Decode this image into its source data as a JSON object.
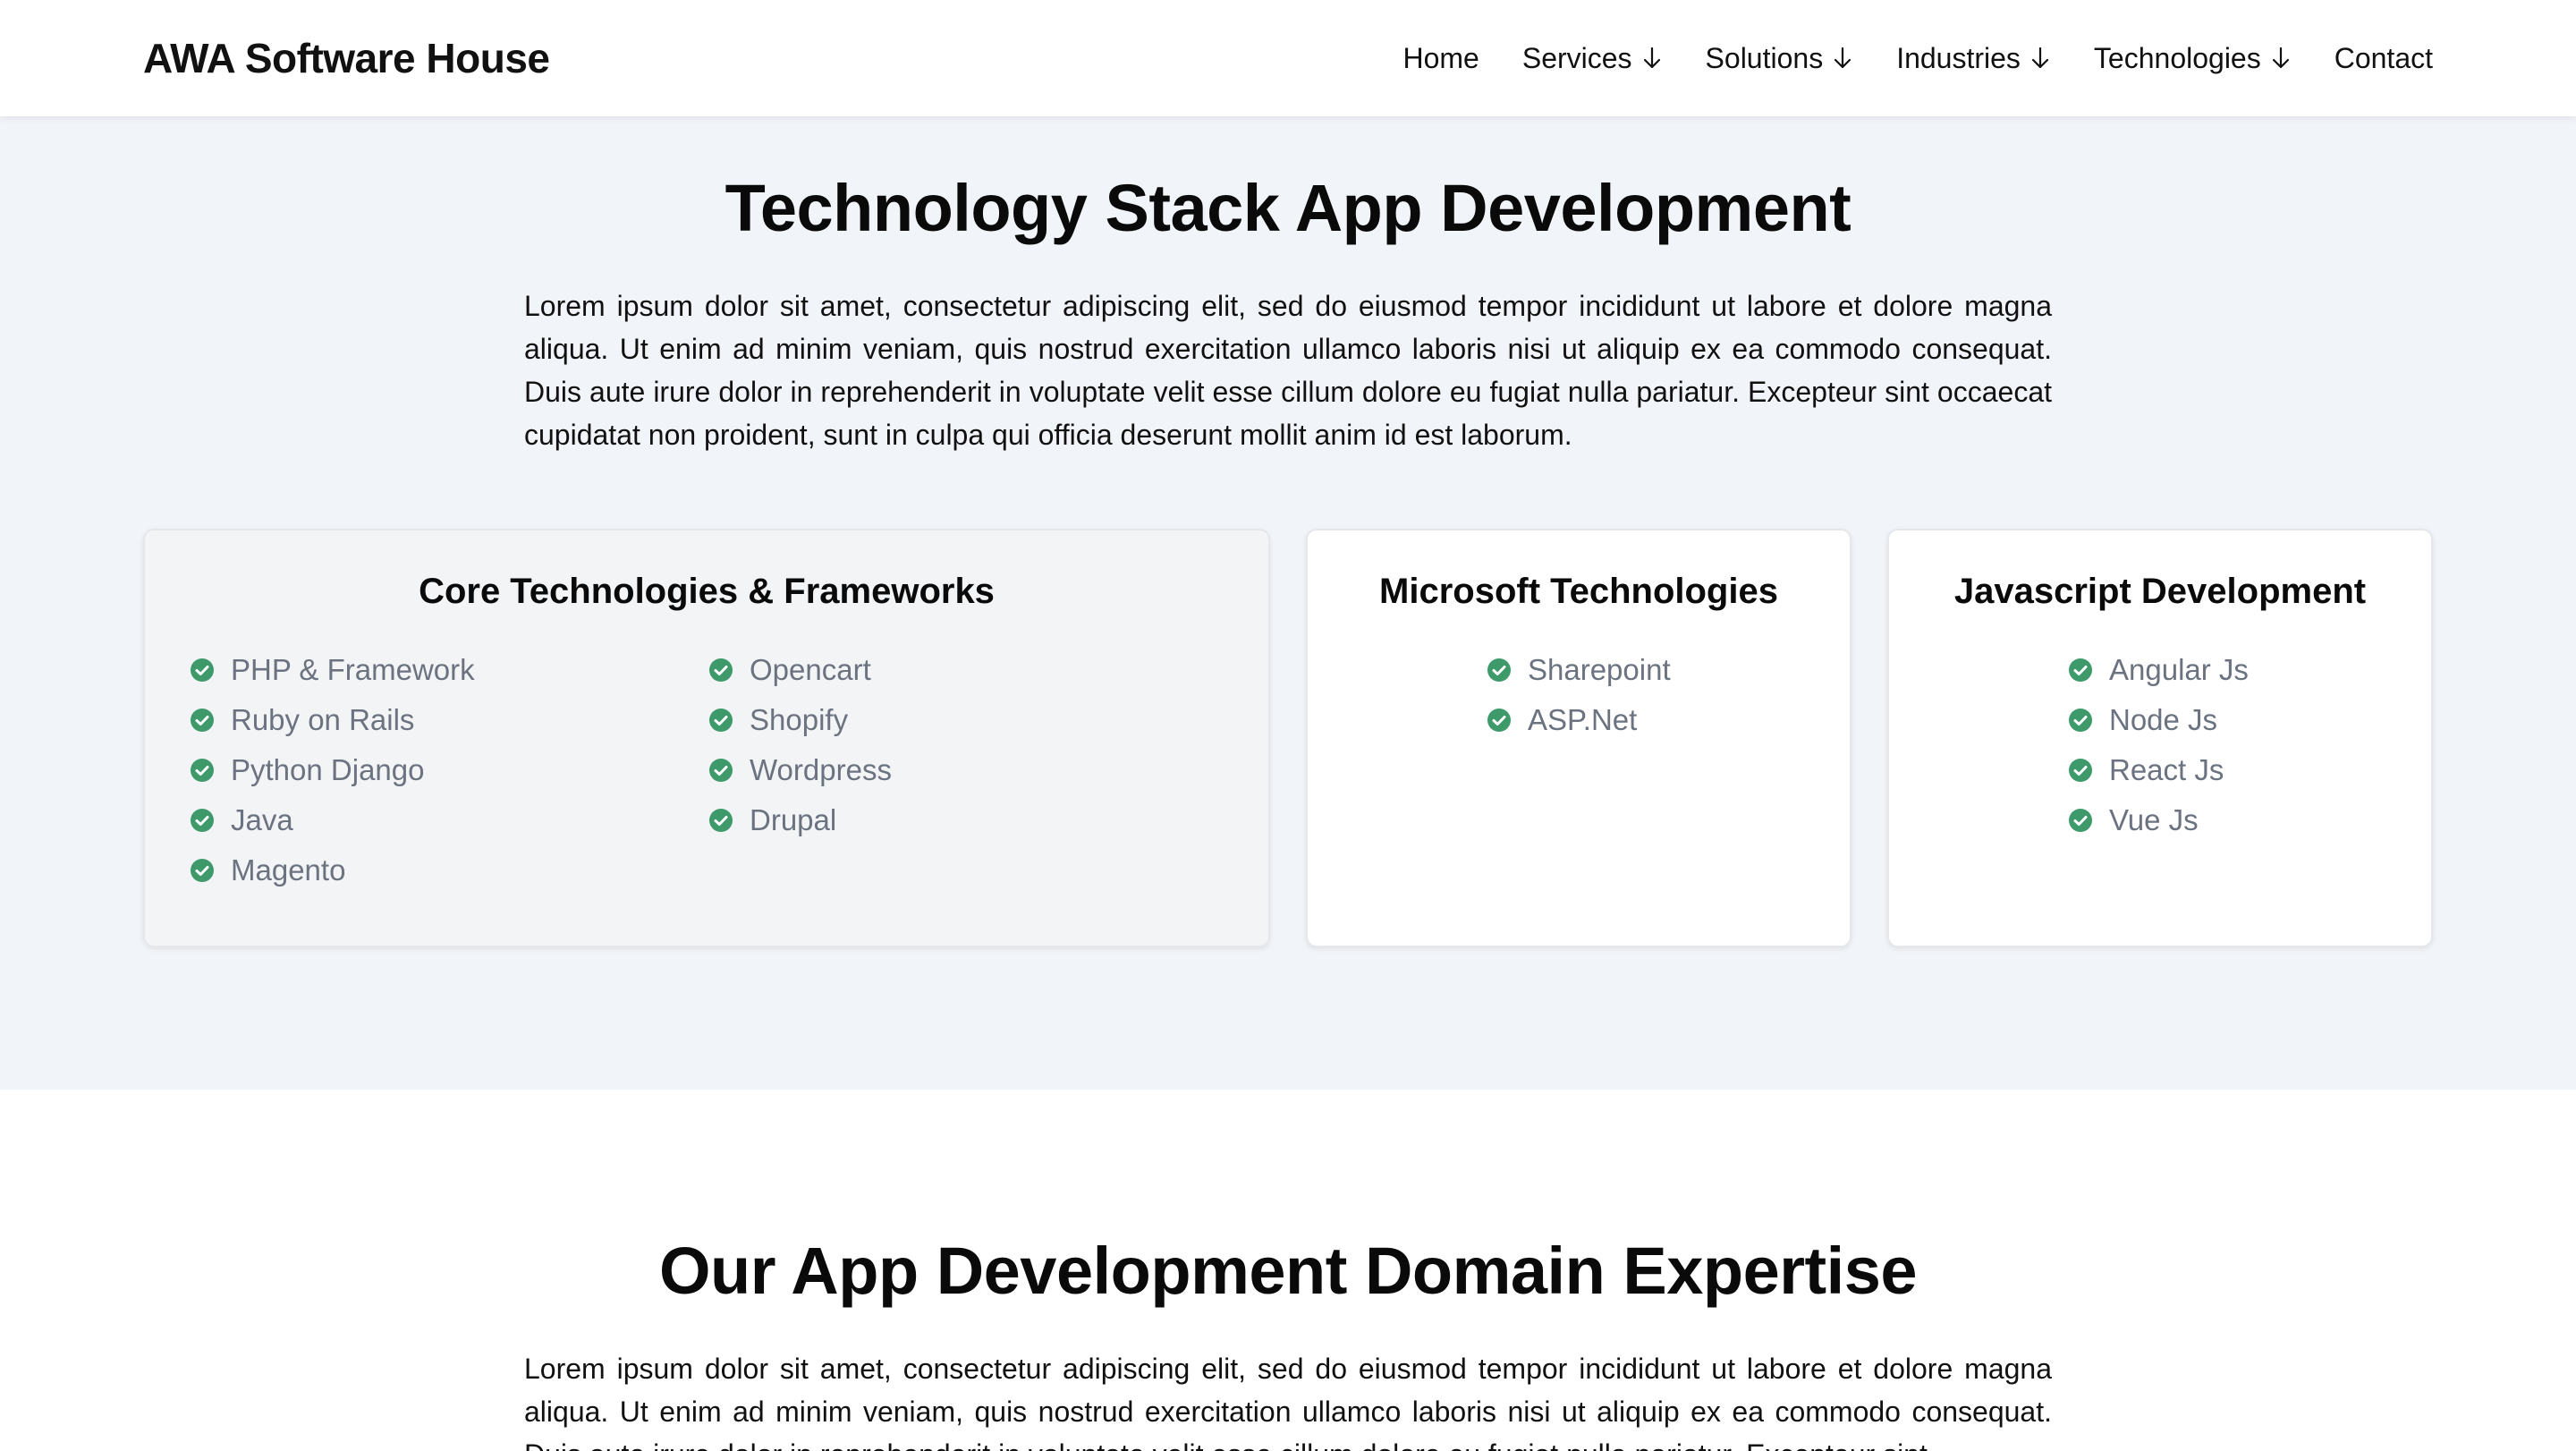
{
  "header": {
    "brand": "AWA Software House",
    "nav": [
      {
        "label": "Home",
        "has_dropdown": false
      },
      {
        "label": "Services",
        "has_dropdown": true
      },
      {
        "label": "Solutions",
        "has_dropdown": true
      },
      {
        "label": "Industries",
        "has_dropdown": true
      },
      {
        "label": "Technologies",
        "has_dropdown": true
      },
      {
        "label": "Contact",
        "has_dropdown": false
      }
    ]
  },
  "tech_section": {
    "title": "Technology Stack App Development",
    "intro": "Lorem ipsum dolor sit amet, consectetur adipiscing elit, sed do eiusmod tempor incididunt ut labore et dolore magna aliqua. Ut enim ad minim veniam, quis nostrud exercitation ullamco laboris nisi ut aliquip ex ea commodo consequat. Duis aute irure dolor in reprehenderit in voluptate velit esse cillum dolore eu fugiat nulla pariatur. Excepteur sint occaecat cupidatat non proident, sunt in culpa qui officia deserunt mollit anim id est laborum.",
    "cards": {
      "core": {
        "title": "Core Technologies & Frameworks",
        "col1": [
          "PHP & Framework",
          "Ruby on Rails",
          "Python Django",
          "Java",
          "Magento"
        ],
        "col2": [
          "Opencart",
          "Shopify",
          "Wordpress",
          "Drupal"
        ]
      },
      "microsoft": {
        "title": "Microsoft Technologies",
        "items": [
          "Sharepoint",
          "ASP.Net"
        ]
      },
      "javascript": {
        "title": "Javascript Development",
        "items": [
          "Angular Js",
          "Node Js",
          "React Js",
          "Vue Js"
        ]
      }
    }
  },
  "domain_section": {
    "title": "Our App Development Domain Expertise",
    "intro": "Lorem ipsum dolor sit amet, consectetur adipiscing elit, sed do eiusmod tempor incididunt ut labore et dolore magna aliqua. Ut enim ad minim veniam, quis nostrud exercitation ullamco laboris nisi ut aliquip ex ea commodo consequat. Duis aute irure dolor in reprehenderit in voluptate velit esse cillum dolore eu fugiat nulla pariatur. Excepteur sint"
  },
  "colors": {
    "check_icon": "#3f9a6b",
    "section_bg": "#f1f4f8",
    "list_text": "#6b7280"
  },
  "icons": {
    "dropdown": "arrow-down-icon",
    "list_bullet": "check-circle-icon"
  }
}
